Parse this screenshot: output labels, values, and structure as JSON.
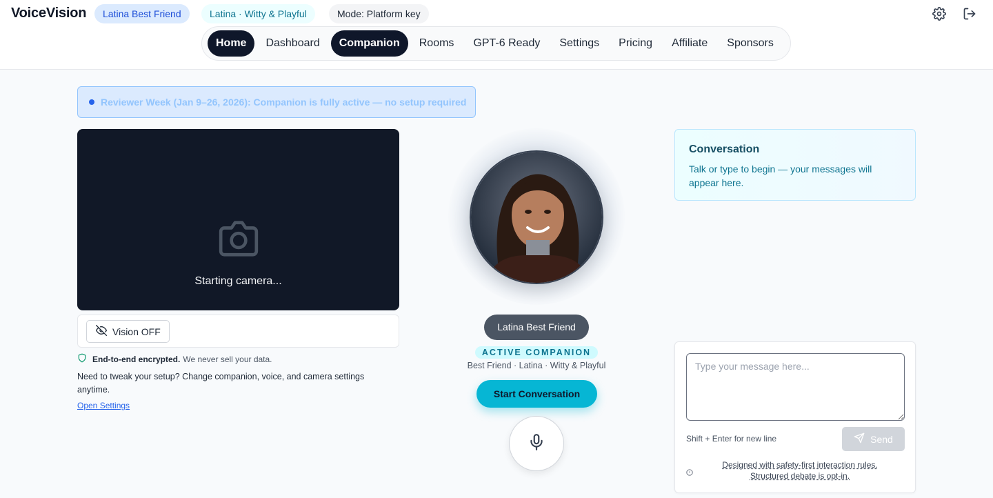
{
  "header": {
    "brand": "VoiceVision",
    "chips": [
      "Latina Best Friend",
      "Latina · Witty & Playful",
      "Mode: Platform key"
    ],
    "icons": [
      "settings-gear-icon",
      "logout-icon"
    ]
  },
  "nav": {
    "items": [
      "Home",
      "Dashboard",
      "Companion",
      "Rooms",
      "GPT-6 Ready",
      "Settings",
      "Pricing",
      "Affiliate",
      "Sponsors"
    ],
    "active": [
      "Home",
      "Companion"
    ]
  },
  "banner": {
    "text": "Reviewer Week (Jan 9–26, 2026): Companion is fully active — no setup required"
  },
  "camera": {
    "status": "Starting camera...",
    "vision_button": "Vision OFF"
  },
  "privacy": {
    "bold": "End-to-end encrypted.",
    "text": "We never sell your data."
  },
  "tweak": {
    "text": "Need to tweak your setup? Change companion, voice, and camera settings anytime.",
    "link": "Open Settings"
  },
  "companion": {
    "name": "Latina Best Friend",
    "badge": "ACTIVE COMPANION",
    "subtitle": "Best Friend · Latina · Witty & Playful",
    "start_button": "Start Conversation"
  },
  "conversation": {
    "title": "Conversation",
    "empty_text": "Talk or type to begin — your messages will appear here."
  },
  "composer": {
    "placeholder": "Type your message here...",
    "hint": "Shift + Enter for new line",
    "send": "Send",
    "safety_line1": "Designed with safety-first interaction rules.",
    "safety_line2": "Structured debate is opt-in."
  },
  "colors": {
    "primary_dark": "#0f172a",
    "accent_cyan": "#06b6d4",
    "banner_bg": "#dbeafe",
    "camera_bg": "#111827"
  }
}
